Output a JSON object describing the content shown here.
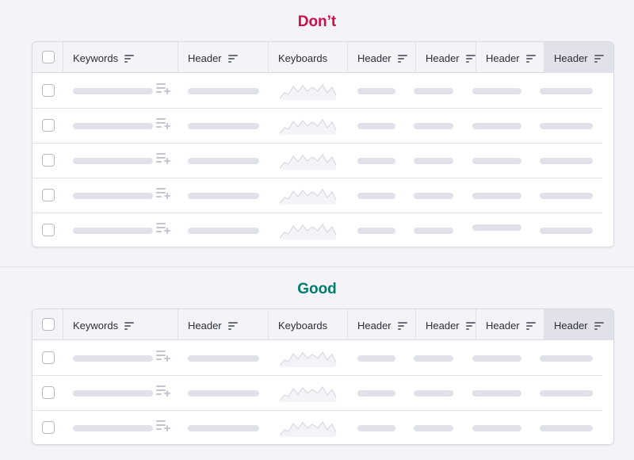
{
  "dont": {
    "title": "Don’t",
    "title_color": "#cc0f4a",
    "columns": [
      "Keywords",
      "Header",
      "Keyboards",
      "Header",
      "Header",
      "Header",
      "Header"
    ],
    "row_count": 5
  },
  "good": {
    "title": "Good",
    "title_color": "#007d6b",
    "columns": [
      "Keywords",
      "Header",
      "Keyboards",
      "Header",
      "Header",
      "Header",
      "Header"
    ],
    "row_count": 3
  },
  "icons": {
    "sort": "sort-icon",
    "add_to_list": "add-to-list-icon",
    "sparkline": "sparkline-chart",
    "checkbox": "checkbox"
  },
  "colors": {
    "skeleton": "#e0e1e9",
    "sparkline_fill": "#f4f4f8",
    "highlighted_header": "#e0e1e9"
  }
}
